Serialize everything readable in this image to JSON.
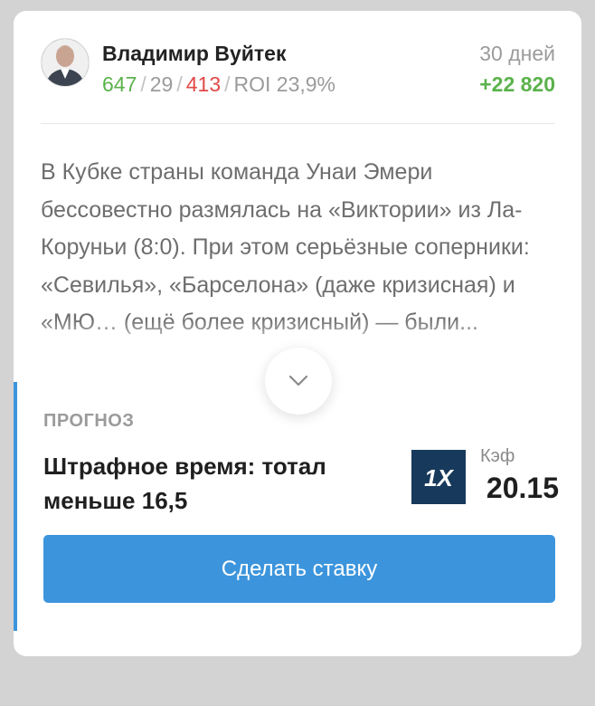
{
  "author": {
    "name": "Владимир Вуйтек",
    "stats": {
      "wins": "647",
      "returns": "29",
      "losses": "413",
      "roi": "ROI 23,9%"
    },
    "period": "30 дней",
    "profit": "+22 820"
  },
  "post": {
    "text": "В Кубке страны команда Унаи Эмери бессовестно размялась на «Виктории» из Ла-Коруньи (8:0). При этом серьёзные соперники: «Севилья», «Барселона» (даже кризисная) и «МЮ… (ещё более кризисный) — были..."
  },
  "forecast": {
    "label": "ПРОГНОЗ",
    "title": "Штрафное время: тотал меньше 16,5",
    "bookmaker_icon": "1xbet-logo",
    "bookmaker_logo_text": "1X",
    "kef_label": "Кэф",
    "kef_value": "20.15",
    "button_label": "Сделать ставку"
  },
  "colors": {
    "win": "#5bb24c",
    "loss": "#e04848",
    "accent": "#3c95dc",
    "bookmaker_bg": "#173a5c"
  }
}
